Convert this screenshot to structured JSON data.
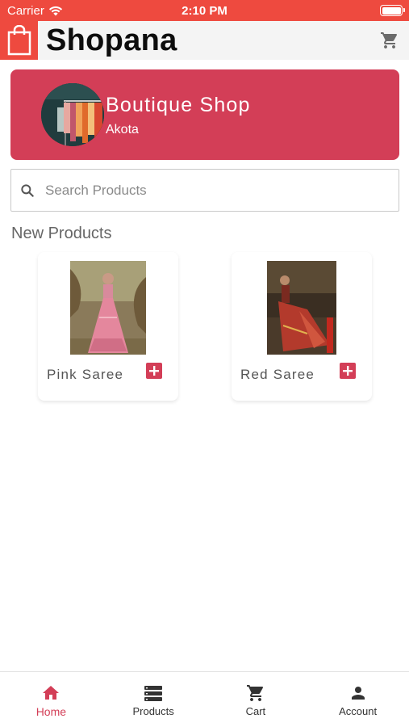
{
  "status_bar": {
    "carrier": "Carrier",
    "time": "2:10 PM",
    "icons": [
      "wifi-icon",
      "battery-icon"
    ]
  },
  "header": {
    "title": "Shopana",
    "logo_icon": "shopping-bag-icon",
    "cart_icon": "cart-icon",
    "accent_color": "#ee4a3f"
  },
  "shop": {
    "name": "Boutique Shop",
    "location": "Akota",
    "card_color": "#d33e57"
  },
  "search": {
    "placeholder": "Search Products",
    "value": "",
    "icon": "search-icon"
  },
  "section": {
    "title": "New Products"
  },
  "products": [
    {
      "name": "Pink Saree",
      "add_icon": "plus-icon"
    },
    {
      "name": "Red Saree",
      "add_icon": "plus-icon"
    }
  ],
  "bottom_nav": {
    "items": [
      {
        "label": "Home",
        "icon": "home-icon",
        "active": true
      },
      {
        "label": "Products",
        "icon": "products-list-icon",
        "active": false
      },
      {
        "label": "Cart",
        "icon": "cart-icon",
        "active": false
      },
      {
        "label": "Account",
        "icon": "person-icon",
        "active": false
      }
    ],
    "active_color": "#d33e57"
  }
}
